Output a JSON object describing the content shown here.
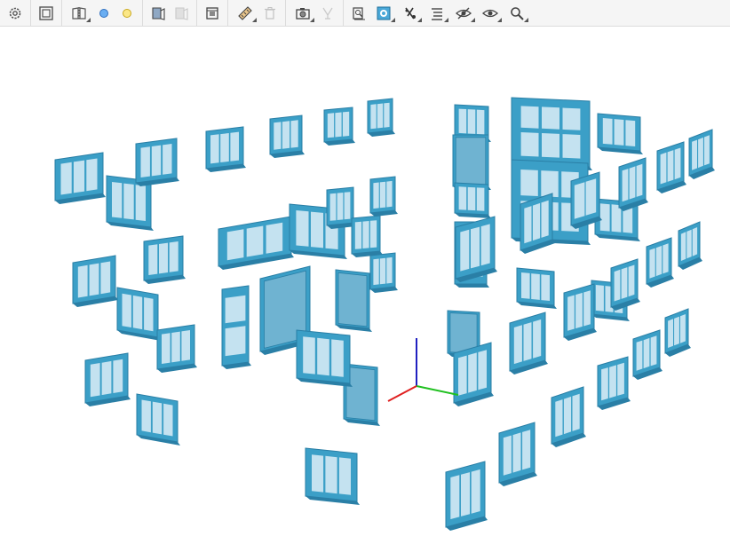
{
  "toolbar": {
    "tools": [
      {
        "icon": "gear-icon",
        "enabled": true,
        "dropdown": false
      },
      {
        "icon": "fit-view-icon",
        "enabled": true,
        "dropdown": false
      },
      {
        "icon": "section-book-icon",
        "enabled": true,
        "dropdown": true
      },
      {
        "icon": "blue-dot-icon",
        "enabled": true,
        "dropdown": false
      },
      {
        "icon": "yellow-dot-icon",
        "enabled": true,
        "dropdown": false
      },
      {
        "icon": "isolate-icon",
        "enabled": true,
        "dropdown": false
      },
      {
        "icon": "isolate-off-icon",
        "enabled": false,
        "dropdown": false
      },
      {
        "icon": "model-box-icon",
        "enabled": true,
        "dropdown": false
      },
      {
        "icon": "measure-icon",
        "enabled": true,
        "dropdown": true
      },
      {
        "icon": "trash-icon",
        "enabled": false,
        "dropdown": false
      },
      {
        "icon": "camera-icon",
        "enabled": true,
        "dropdown": true
      },
      {
        "icon": "markup-icon",
        "enabled": false,
        "dropdown": false
      },
      {
        "icon": "properties-icon",
        "enabled": true,
        "dropdown": false
      },
      {
        "icon": "render-mode-icon",
        "enabled": true,
        "dropdown": true
      },
      {
        "icon": "explode-icon",
        "enabled": true,
        "dropdown": true
      },
      {
        "icon": "list-icon",
        "enabled": true,
        "dropdown": true
      },
      {
        "icon": "hide-icon",
        "enabled": true,
        "dropdown": true
      },
      {
        "icon": "show-icon",
        "enabled": true,
        "dropdown": true
      },
      {
        "icon": "search-icon",
        "enabled": true,
        "dropdown": true
      }
    ]
  },
  "colors": {
    "frame": "#3b9fc7",
    "frame_dark": "#2a7fa6",
    "glass": "#c4e2f0",
    "door_panel": "#6fb3d1",
    "axis_x": "#e02020",
    "axis_y": "#20c020",
    "axis_z": "#2020c0",
    "toolbar_bg": "#f5f5f5"
  }
}
